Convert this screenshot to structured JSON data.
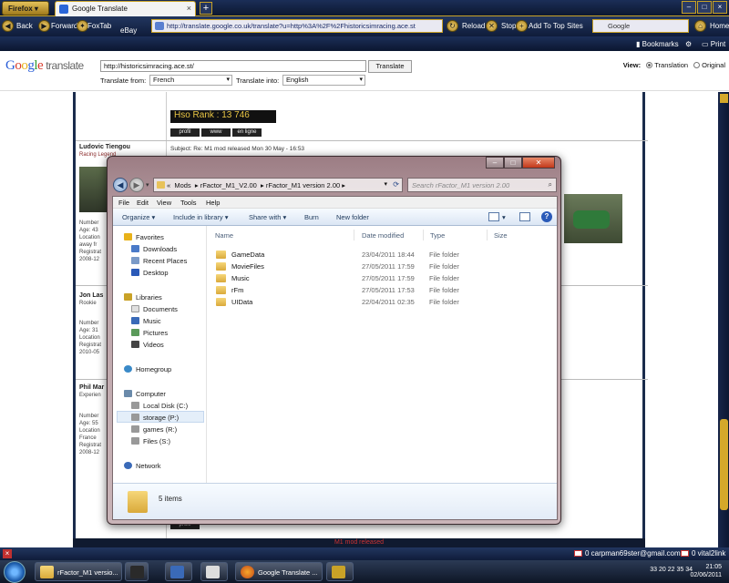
{
  "browser": {
    "menu_button": "Firefox",
    "tab_title": "Google Translate",
    "new_tab": "+",
    "nav": {
      "back": "Back",
      "forward": "Forward",
      "foxtab": "FoxTab",
      "ebay": "eBay",
      "url": "http://translate.google.co.uk/translate?u=http%3A%2F%2Fhistoricsimracing.ace.st",
      "reload": "Reload",
      "stop": "Stop",
      "add_top_sites": "Add To Top Sites",
      "search_placeholder": "Google",
      "home": "Home"
    },
    "bookmarks": {
      "bookmarks": "Bookmarks",
      "print": "Print"
    }
  },
  "translate": {
    "logo_google": "Google",
    "logo_translate": "translate",
    "url_value": "http://historicsimracing.ace.st/",
    "button": "Translate",
    "from_label": "Translate from:",
    "from_value": "French",
    "into_label": "Translate into:",
    "into_value": "English",
    "view_label": "View:",
    "view_translation": "Translation",
    "view_original": "Original"
  },
  "forum": {
    "rank_text": "Hso Rank : 13 746",
    "buttons": [
      "profil",
      "www",
      "en ligne"
    ],
    "poster1_name": "Ludovic Tiengou",
    "poster1_title": "Racing Legend",
    "poster1_meta": [
      "Number",
      "Age: 43",
      "Location",
      "away fr",
      "Registrat",
      "2008-12"
    ],
    "subject": "Subject: Re: M1 mod released   Mon 30 May - 16:53",
    "poster2_name": "Jon Las",
    "poster2_title": "Rookie",
    "poster2_meta": [
      "Number",
      "Age: 31",
      "Location",
      "Registrat",
      "2010-05"
    ],
    "poster3_name": "Phil Mar",
    "poster3_title": "Experien",
    "poster3_meta": [
      "Number",
      "Age: 55",
      "Location",
      "France",
      "Registrat",
      "2008-12"
    ],
    "bottom_button": "profil",
    "footer_text": "M1 mod released"
  },
  "explorer": {
    "breadcrumb": [
      "«",
      "Mods",
      "rFactor_M1_V2.00",
      "rFactor_M1 version 2.00"
    ],
    "search_placeholder": "Search rFactor_M1 version 2.00",
    "menu": [
      "File",
      "Edit",
      "View",
      "Tools",
      "Help"
    ],
    "commands": [
      "Organize",
      "Include in library",
      "Share with",
      "Burn",
      "New folder"
    ],
    "nav_pane": {
      "favorites": "Favorites",
      "favorites_items": [
        "Downloads",
        "Recent Places",
        "Desktop"
      ],
      "libraries": "Libraries",
      "libraries_items": [
        "Documents",
        "Music",
        "Pictures",
        "Videos"
      ],
      "homegroup": "Homegroup",
      "computer": "Computer",
      "drives": [
        "Local Disk (C:)",
        "storage (P:)",
        "games (R:)",
        "Files (S:)"
      ],
      "network": "Network"
    },
    "columns": [
      "Name",
      "Date modified",
      "Type",
      "Size"
    ],
    "files": [
      {
        "name": "GameData",
        "date": "23/04/2011 18:44",
        "type": "File folder"
      },
      {
        "name": "MovieFiles",
        "date": "27/05/2011 17:59",
        "type": "File folder"
      },
      {
        "name": "Music",
        "date": "27/05/2011 17:59",
        "type": "File folder"
      },
      {
        "name": "rFm",
        "date": "27/05/2011 17:53",
        "type": "File folder"
      },
      {
        "name": "UIData",
        "date": "22/04/2011 02:35",
        "type": "File folder"
      }
    ],
    "item_count": "5 items"
  },
  "statusbar": {
    "mail1": "0 carpman69ster@gmail.com",
    "mail2": "0 vital2link"
  },
  "taskbar": {
    "items": [
      "rFactor_M1 versio...",
      "Google Translate ..."
    ],
    "tray": "33  20  22  35  34",
    "time": "21:05",
    "date": "02/06/2011"
  },
  "colors": {
    "accent_gold": "#c9a227",
    "chrome_navy": "#0f1c3a",
    "explorer_frame": "#bca4a9"
  }
}
